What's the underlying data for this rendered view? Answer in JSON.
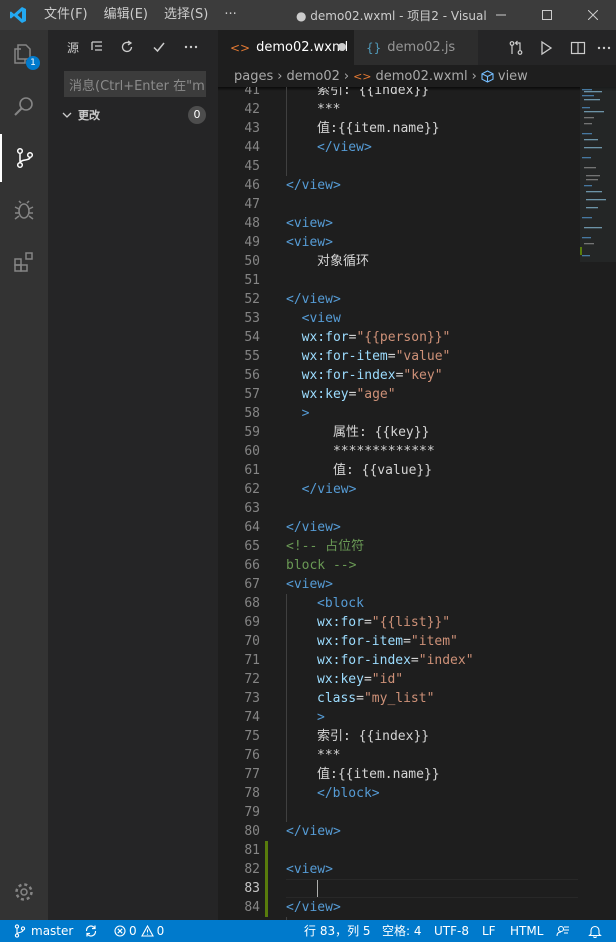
{
  "titlebar": {
    "menu": [
      "文件(F)",
      "编辑(E)",
      "选择(S)",
      "···"
    ],
    "title": "● demo02.wxml - 项目2 - Visual ..."
  },
  "activitybar": {
    "icons": [
      "explorer-icon",
      "search-icon",
      "source-control-icon",
      "debug-icon",
      "extensions-icon",
      "settings-gear-icon"
    ],
    "explorer_badge": "1"
  },
  "sidebar": {
    "header_label": "源",
    "message_placeholder": "消息(Ctrl+Enter 在\"m...",
    "changes_label": "更改",
    "changes_count": "0"
  },
  "tabs": [
    {
      "label": "demo02.wxml",
      "icon": "<>",
      "active": true,
      "dirty": true
    },
    {
      "label": "demo02.js",
      "icon": "{}",
      "active": false
    }
  ],
  "breadcrumb": [
    "pages",
    "demo02",
    "demo02.wxml",
    "view"
  ],
  "editor": {
    "current_line": 83,
    "lines": [
      {
        "n": "41",
        "i": 1,
        "html": "<span class=\"t\">索引: {{index}}</span>"
      },
      {
        "n": "42",
        "i": 1,
        "html": "<span class=\"t\">***</span>"
      },
      {
        "n": "43",
        "i": 1,
        "html": "<span class=\"t\">值:{{item.name}}</span>"
      },
      {
        "n": "44",
        "i": 1,
        "html": "<span class=\"tag\">&lt;/view&gt;</span>"
      },
      {
        "n": "45",
        "i": 0,
        "html": ""
      },
      {
        "n": "46",
        "i": 0,
        "html": "<span class=\"tag\">&lt;/view&gt;</span>"
      },
      {
        "n": "47",
        "i": 0,
        "html": ""
      },
      {
        "n": "48",
        "i": 0,
        "html": "<span class=\"tag\">&lt;view&gt;</span>"
      },
      {
        "n": "49",
        "i": 0,
        "html": "<span class=\"tag\">&lt;view&gt;</span>"
      },
      {
        "n": "50",
        "i": 1,
        "html": "<span class=\"t\">对象循环</span>"
      },
      {
        "n": "51",
        "i": 0,
        "html": ""
      },
      {
        "n": "52",
        "i": 0,
        "html": "<span class=\"tag\">&lt;/view&gt;</span>"
      },
      {
        "n": "53",
        "i": 0,
        "html": "  <span class=\"tag\">&lt;view</span>"
      },
      {
        "n": "54",
        "i": 0,
        "html": "  <span class=\"attr\">wx:for</span><span class=\"t\">=</span><span class=\"str\">\"{{person}}\"</span>"
      },
      {
        "n": "55",
        "i": 0,
        "html": "  <span class=\"attr\">wx:for-item</span><span class=\"t\">=</span><span class=\"str\">\"value\"</span>"
      },
      {
        "n": "56",
        "i": 0,
        "html": "  <span class=\"attr\">wx:for-index</span><span class=\"t\">=</span><span class=\"str\">\"key\"</span>"
      },
      {
        "n": "57",
        "i": 0,
        "html": "  <span class=\"attr\">wx:key</span><span class=\"t\">=</span><span class=\"str\">\"age\"</span>"
      },
      {
        "n": "58",
        "i": 0,
        "html": "  <span class=\"tag\">&gt;</span>"
      },
      {
        "n": "59",
        "i": 0,
        "html": "      <span class=\"t\">属性: {{key}}</span>"
      },
      {
        "n": "60",
        "i": 0,
        "html": "      <span class=\"t\">*************</span>"
      },
      {
        "n": "61",
        "i": 0,
        "html": "      <span class=\"t\">值: {{value}}</span>"
      },
      {
        "n": "62",
        "i": 0,
        "html": "  <span class=\"tag\">&lt;/view&gt;</span>"
      },
      {
        "n": "63",
        "i": 0,
        "html": ""
      },
      {
        "n": "64",
        "i": 0,
        "html": "<span class=\"tag\">&lt;/view&gt;</span>"
      },
      {
        "n": "65",
        "i": 0,
        "html": "<span class=\"cmt\">&lt;!-- 占位符</span>"
      },
      {
        "n": "66",
        "i": 0,
        "html": "<span class=\"cmt\">block --&gt;</span>"
      },
      {
        "n": "67",
        "i": 0,
        "html": "<span class=\"tag\">&lt;view&gt;</span>"
      },
      {
        "n": "68",
        "i": 1,
        "html": "<span class=\"tag\">&lt;block</span>"
      },
      {
        "n": "69",
        "i": 1,
        "html": "<span class=\"attr\">wx:for</span><span class=\"t\">=</span><span class=\"str\">\"{{list}}\"</span>"
      },
      {
        "n": "70",
        "i": 1,
        "html": "<span class=\"attr\">wx:for-item</span><span class=\"t\">=</span><span class=\"str\">\"item\"</span>"
      },
      {
        "n": "71",
        "i": 1,
        "html": "<span class=\"attr\">wx:for-index</span><span class=\"t\">=</span><span class=\"str\">\"index\"</span>"
      },
      {
        "n": "72",
        "i": 1,
        "html": "<span class=\"attr\">wx:key</span><span class=\"t\">=</span><span class=\"str\">\"id\"</span>"
      },
      {
        "n": "73",
        "i": 1,
        "html": "<span class=\"attr\">class</span><span class=\"t\">=</span><span class=\"str\">\"my_list\"</span>"
      },
      {
        "n": "74",
        "i": 1,
        "html": "<span class=\"tag\">&gt;</span>"
      },
      {
        "n": "75",
        "i": 1,
        "html": "<span class=\"t\">索引: {{index}}</span>"
      },
      {
        "n": "76",
        "i": 1,
        "html": "<span class=\"t\">***</span>"
      },
      {
        "n": "77",
        "i": 1,
        "html": "<span class=\"t\">值:{{item.name}}</span>"
      },
      {
        "n": "78",
        "i": 1,
        "html": "<span class=\"tag\">&lt;/block&gt;</span>"
      },
      {
        "n": "79",
        "i": 0,
        "html": ""
      },
      {
        "n": "80",
        "i": 0,
        "html": "<span class=\"tag\">&lt;/view&gt;</span>"
      },
      {
        "n": "81",
        "i": 0,
        "html": ""
      },
      {
        "n": "82",
        "i": 0,
        "html": "<span class=\"tag\">&lt;view&gt;</span>"
      },
      {
        "n": "83",
        "i": 0,
        "html": ""
      },
      {
        "n": "84",
        "i": 0,
        "html": "<span class=\"tag\">&lt;/view&gt;</span>"
      }
    ]
  },
  "statusbar": {
    "branch": "master",
    "errors": "0",
    "warnings": "0",
    "position": "行 83，列 5",
    "spaces": "空格: 4",
    "encoding": "UTF-8",
    "eol": "LF",
    "language": "HTML"
  },
  "colors": {
    "accent": "#007acc",
    "tag": "#569cd6",
    "attribute": "#9cdcfe",
    "string": "#ce9178",
    "comment": "#6a9955",
    "added_gutter": "#587c0c"
  }
}
